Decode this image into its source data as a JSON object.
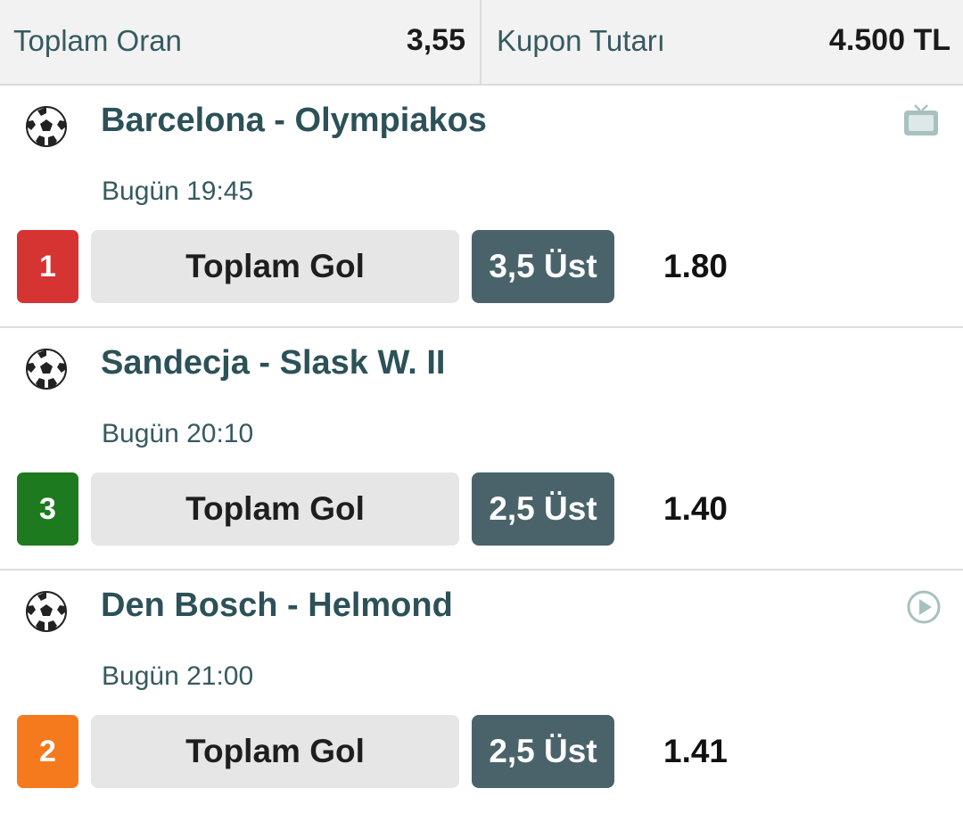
{
  "summary": {
    "total_odds_label": "Toplam Oran",
    "total_odds_value": "3,55",
    "coupon_amount_label": "Kupon Tutarı",
    "coupon_amount_value": "4.500 TL"
  },
  "colors": {
    "team_text": "#2c5158",
    "pick_bg": "#4a636a",
    "market_bg": "#e6e6e6"
  },
  "bets": [
    {
      "sport_icon": "soccer-ball-icon",
      "teams": "Barcelona - Olympiakos",
      "time": "Bugün 19:45",
      "number": "1",
      "number_color": "#d63333",
      "market": "Toplam Gol",
      "pick": "3,5 Üst",
      "odds": "1.80",
      "side_icon": "tv-icon"
    },
    {
      "sport_icon": "soccer-ball-icon",
      "teams": "Sandecja - Slask W. II",
      "time": "Bugün 20:10",
      "number": "3",
      "number_color": "#1e7a1e",
      "market": "Toplam Gol",
      "pick": "2,5 Üst",
      "odds": "1.40",
      "side_icon": ""
    },
    {
      "sport_icon": "soccer-ball-icon",
      "teams": "Den Bosch - Helmond",
      "time": "Bugün 21:00",
      "number": "2",
      "number_color": "#f57a1e",
      "market": "Toplam Gol",
      "pick": "2,5 Üst",
      "odds": "1.41",
      "side_icon": "play-circle-icon"
    }
  ]
}
